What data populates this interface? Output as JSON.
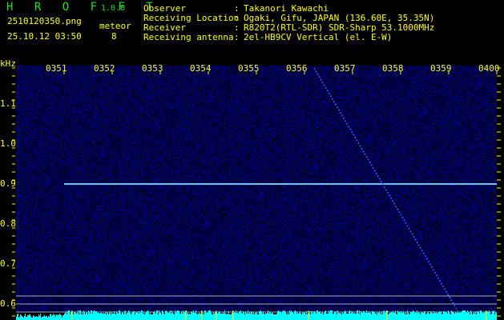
{
  "app": {
    "name": "H R O F F T",
    "version": "1.0.0"
  },
  "file": {
    "filename": "2510120350.png",
    "datetime": "25.10.12 03:50"
  },
  "meteor": {
    "label": "meteor",
    "count": "8"
  },
  "info": [
    {
      "label": "Observer",
      "value": "Takanori Kawachi"
    },
    {
      "label": "Receiving Location",
      "value": "Ogaki, Gifu, JAPAN (136.60E, 35.35N)"
    },
    {
      "label": "Receiver",
      "value": "R820T2(RTL-SDR) SDR-Sharp 53.1000MHz"
    },
    {
      "label": "Receiving antenna",
      "value": "2el-HB9CV Vertical (el. E-W)"
    }
  ],
  "colors": {
    "text": "#ffff00",
    "brand": "#22dd22",
    "background": "#000010",
    "signal": "#00ffff",
    "noise": "#0a0a8c"
  },
  "chart_data": {
    "type": "heatmap",
    "ylabel": "kHz",
    "ylim": [
      0.56,
      1.2
    ],
    "y_ticks": [
      "1.1",
      "1.0",
      "0.9",
      "0.8",
      "0.7",
      "0.6"
    ],
    "y_tick_values": [
      1.1,
      1.0,
      0.9,
      0.8,
      0.7,
      0.6
    ],
    "x_ticks": [
      "0351",
      "0352",
      "0353",
      "0354",
      "0355",
      "0356",
      "0357",
      "0358",
      "0359",
      "0400"
    ],
    "x_range_minutes": [
      0,
      10
    ],
    "features": [
      {
        "kind": "carrier",
        "freq_khz": 0.9,
        "start_min": 1.0,
        "end_min": 10.0
      },
      {
        "kind": "meteor-trail",
        "start": {
          "min": 6.2,
          "freq_khz": 1.19
        },
        "end": {
          "min": 9.2,
          "freq_khz": 0.58
        }
      }
    ],
    "reference_lines_khz": [
      0.62,
      0.6,
      0.58
    ]
  }
}
